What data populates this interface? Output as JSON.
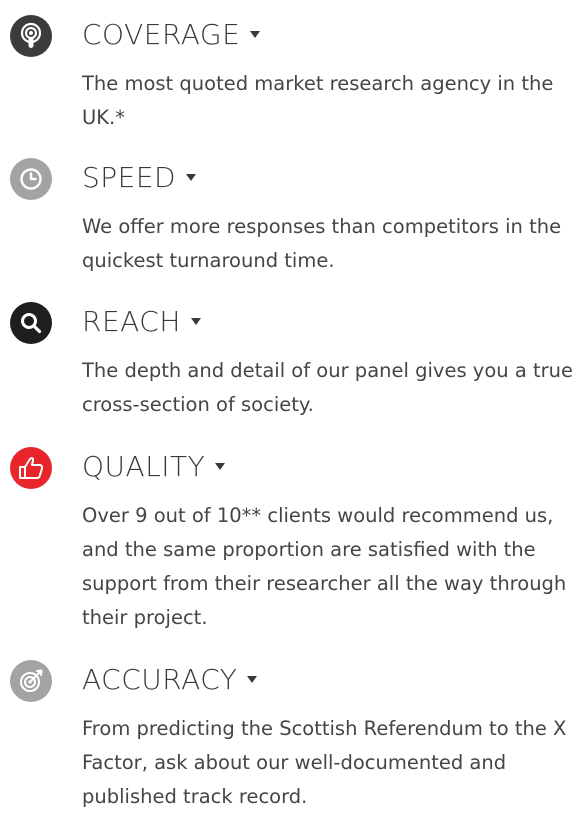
{
  "colors": {
    "coverage_icon": "#3c3c3c",
    "speed_icon": "#a3a3a3",
    "reach_icon": "#1e1e1e",
    "quality_icon": "#e8252b",
    "accuracy_icon": "#a3a3a3",
    "heading_text": "#3a3a3a",
    "body_text": "#454545"
  },
  "features": [
    {
      "heading": "COVERAGE",
      "icon": "podcast-icon",
      "description": "The most quoted market research agency in the UK.*"
    },
    {
      "heading": "SPEED",
      "icon": "clock-icon",
      "description": "We offer more responses than competitors in the quickest turnaround time."
    },
    {
      "heading": "REACH",
      "icon": "search-icon",
      "description": "The depth and detail of our panel gives you a true cross-section of society."
    },
    {
      "heading": "QUALITY",
      "icon": "thumbs-up-icon",
      "description": "Over 9 out of 10** clients would recommend us, and the same proportion are satisfied with the support from their researcher all the way through their project."
    },
    {
      "heading": "ACCURACY",
      "icon": "target-icon",
      "description": "From predicting the Scottish Referendum to the X Factor, ask about our well-documented and published track record."
    }
  ]
}
